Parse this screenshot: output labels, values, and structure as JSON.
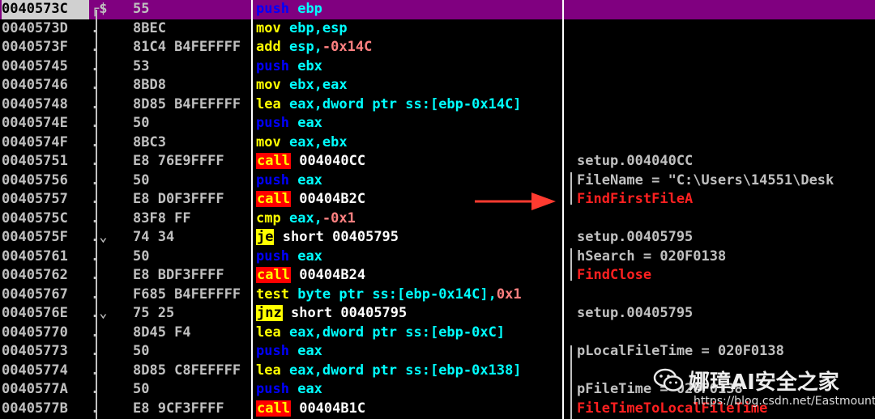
{
  "rows": [
    {
      "addr": "0040573C",
      "mark": "┌$",
      "hex": "55",
      "mn": "push",
      "ops": [
        {
          "t": "ebp",
          "k": "op-push"
        }
      ],
      "cmt": "",
      "cmt_api": false,
      "mnk": "push",
      "selected": true
    },
    {
      "addr": "0040573D",
      "mark": ".",
      "hex": "8BEC",
      "mn": "mov",
      "ops": [
        {
          "t": "ebp,esp",
          "k": "op-std"
        }
      ],
      "cmt": "",
      "cmt_api": false,
      "mnk": "std"
    },
    {
      "addr": "0040573F",
      "mark": ".",
      "hex": "81C4 B4FEFFFF",
      "mn": "add",
      "ops": [
        {
          "t": "esp,",
          "k": "op-std"
        },
        {
          "t": "-0x14C",
          "k": "op-neg"
        }
      ],
      "cmt": "",
      "cmt_api": false,
      "mnk": "std"
    },
    {
      "addr": "00405745",
      "mark": ".",
      "hex": "53",
      "mn": "push",
      "ops": [
        {
          "t": "ebx",
          "k": "op-push"
        }
      ],
      "cmt": "",
      "cmt_api": false,
      "mnk": "push"
    },
    {
      "addr": "00405746",
      "mark": ".",
      "hex": "8BD8",
      "mn": "mov",
      "ops": [
        {
          "t": "ebx,eax",
          "k": "op-std"
        }
      ],
      "cmt": "",
      "cmt_api": false,
      "mnk": "std"
    },
    {
      "addr": "00405748",
      "mark": ".",
      "hex": "8D85 B4FEFFFF",
      "mn": "lea",
      "ops": [
        {
          "t": "eax,dword ptr ss:[ebp-0x14C]",
          "k": "op-std"
        }
      ],
      "cmt": "",
      "cmt_api": false,
      "mnk": "std"
    },
    {
      "addr": "0040574E",
      "mark": ".",
      "hex": "50",
      "mn": "push",
      "ops": [
        {
          "t": "eax",
          "k": "op-push"
        }
      ],
      "cmt": "",
      "cmt_api": false,
      "mnk": "push"
    },
    {
      "addr": "0040574F",
      "mark": ".",
      "hex": "8BC3",
      "mn": "mov",
      "ops": [
        {
          "t": "eax,ebx",
          "k": "op-std"
        }
      ],
      "cmt": "",
      "cmt_api": false,
      "mnk": "std"
    },
    {
      "addr": "00405751",
      "mark": ".",
      "hex": "E8 76E9FFFF",
      "mn": "call",
      "ops": [
        {
          "t": "004040CC",
          "k": "op-call"
        }
      ],
      "cmt": "setup.004040CC",
      "cmt_api": false,
      "mnk": "call"
    },
    {
      "addr": "00405756",
      "mark": ".",
      "hex": "50",
      "mn": "push",
      "ops": [
        {
          "t": "eax",
          "k": "op-push"
        }
      ],
      "cmt": "FileName = \"C:\\Users\\14551\\Desk",
      "cmt_api": false,
      "mnk": "push"
    },
    {
      "addr": "00405757",
      "mark": ".",
      "hex": "E8 D0F3FFFF",
      "mn": "call",
      "ops": [
        {
          "t": "00404B2C",
          "k": "op-call"
        }
      ],
      "cmt": "FindFirstFileA",
      "cmt_api": true,
      "mnk": "call"
    },
    {
      "addr": "0040575C",
      "mark": ".",
      "hex": "83F8 FF",
      "mn": "cmp",
      "ops": [
        {
          "t": "eax,",
          "k": "op-std"
        },
        {
          "t": "-0x1",
          "k": "op-neg"
        }
      ],
      "cmt": "",
      "cmt_api": false,
      "mnk": "std"
    },
    {
      "addr": "0040575F",
      "mark": ".⌄",
      "hex": "74 34",
      "mn": "je",
      "ops": [
        {
          "t": "short 00405795",
          "k": "op-jmp"
        }
      ],
      "cmt": "setup.00405795",
      "cmt_api": false,
      "mnk": "jmp"
    },
    {
      "addr": "00405761",
      "mark": ".",
      "hex": "50",
      "mn": "push",
      "ops": [
        {
          "t": "eax",
          "k": "op-push"
        }
      ],
      "cmt": "hSearch = 020F0138",
      "cmt_api": false,
      "mnk": "push"
    },
    {
      "addr": "00405762",
      "mark": ".",
      "hex": "E8 BDF3FFFF",
      "mn": "call",
      "ops": [
        {
          "t": "00404B24",
          "k": "op-call"
        }
      ],
      "cmt": "FindClose",
      "cmt_api": true,
      "mnk": "call"
    },
    {
      "addr": "00405767",
      "mark": ".",
      "hex": "F685 B4FEFFFF",
      "mn": "test",
      "ops": [
        {
          "t": "byte ptr ss:[ebp-0x14C],",
          "k": "op-std"
        },
        {
          "t": "0x1",
          "k": "op-neg"
        }
      ],
      "cmt": "",
      "cmt_api": false,
      "mnk": "std"
    },
    {
      "addr": "0040576E",
      "mark": ".⌄",
      "hex": "75 25",
      "mn": "jnz",
      "ops": [
        {
          "t": "short 00405795",
          "k": "op-jmp"
        }
      ],
      "cmt": "setup.00405795",
      "cmt_api": false,
      "mnk": "jmp"
    },
    {
      "addr": "00405770",
      "mark": ".",
      "hex": "8D45 F4",
      "mn": "lea",
      "ops": [
        {
          "t": "eax,dword ptr ss:[ebp-0xC]",
          "k": "op-std"
        }
      ],
      "cmt": "",
      "cmt_api": false,
      "mnk": "std"
    },
    {
      "addr": "00405773",
      "mark": ".",
      "hex": "50",
      "mn": "push",
      "ops": [
        {
          "t": "eax",
          "k": "op-push"
        }
      ],
      "cmt": "pLocalFileTime = 020F0138",
      "cmt_api": false,
      "mnk": "push"
    },
    {
      "addr": "00405774",
      "mark": ".",
      "hex": "8D85 C8FEFFFF",
      "mn": "lea",
      "ops": [
        {
          "t": "eax,dword ptr ss:[ebp-0x138]",
          "k": "op-std"
        }
      ],
      "cmt": "",
      "cmt_api": false,
      "mnk": "std"
    },
    {
      "addr": "0040577A",
      "mark": ".",
      "hex": "50",
      "mn": "push",
      "ops": [
        {
          "t": "eax",
          "k": "op-push"
        }
      ],
      "cmt": "pFileTime = 020F0138",
      "cmt_api": false,
      "mnk": "push"
    },
    {
      "addr": "0040577B",
      "mark": ".",
      "hex": "E8 9CF3FFFF",
      "mn": "call",
      "ops": [
        {
          "t": "00404B1C",
          "k": "op-call"
        }
      ],
      "cmt": "FileTimeToLocalFileTime",
      "cmt_api": true,
      "mnk": "call"
    }
  ],
  "watermark": {
    "icon": "wechat-icon",
    "text": "娜璋AI安全之家",
    "url": "https://blog.csdn.net/Eastmount"
  },
  "colors": {
    "selected_row": "#800080",
    "call_bg": "#ff0000",
    "jmp_bg": "#ffff00",
    "api_comment": "#ff2020",
    "arrow": "#ff3b30"
  }
}
